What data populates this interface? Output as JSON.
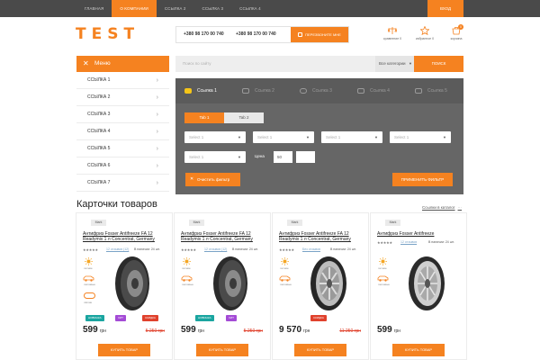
{
  "topnav": {
    "items": [
      "Главная",
      "О компании",
      "Ссылка 2",
      "Ссылка 3",
      "Ссылка 4"
    ],
    "active_index": 1,
    "login_label": "Вход"
  },
  "header": {
    "logo": "TEST",
    "phone1": "+380 98 170 00 740",
    "phone2": "+380 98 170 00 740",
    "callback_label": "Перезвоните мне",
    "compare_label": "сравнение 0",
    "favorites_label": "избранное 0",
    "cart_label": "корзина",
    "cart_count": "0"
  },
  "sidebar": {
    "menu_title": "Меню",
    "items": [
      "Ссылка 1",
      "Ссылка 2",
      "Ссылка 3",
      "Ссылка 4",
      "Ссылка 5",
      "Ссылка 6",
      "Ссылка 7"
    ]
  },
  "search": {
    "placeholder": "Поиск по сайту",
    "category": "Все категории",
    "button": "Поиск"
  },
  "filter": {
    "tabs": [
      "Ссылка 1",
      "Ссылка 2",
      "Ссылка 3",
      "Ссылка 4",
      "Ссылка 5"
    ],
    "subtabs": [
      "Tab 1",
      "Tab 2"
    ],
    "selects": [
      "Select 1",
      "Select 1",
      "Select 1",
      "Select 1",
      "Select 1"
    ],
    "price_label": "Цена",
    "price_from": "50",
    "price_to": "",
    "clear_label": "Очистить фильтр",
    "apply_label": "Применить фильтр"
  },
  "catalog": {
    "title": "Карточки товаров",
    "all_link": "Ссылки в каталог",
    "more": "···",
    "cards": [
      {
        "mark": "Mark",
        "name": "Антифриз Fosser Antifreeze FA 12 Readymix 1 л Concentrat, Germany",
        "reviews": "12 отзывов (12)",
        "stock": "В наличии: 24 шт.",
        "season": "летние",
        "car": "легковые",
        "extra": "лёгкие",
        "badges": [
          "Новинка",
          "Хит",
          "Скидка"
        ],
        "price": "599",
        "currency": "грн",
        "old_price": "5 250 грн",
        "buy": "Купить товар"
      },
      {
        "mark": "Mark",
        "name": "Антифриз Fosser Antifreeze FA 12 Readymix 1 л Concentrat, Germany",
        "reviews": "12 отзывов (12)",
        "stock": "В наличии: 24 шт.",
        "season": "летние",
        "car": "легковые",
        "extra": "",
        "badges": [
          "Новинка",
          "Хит"
        ],
        "price": "599",
        "currency": "грн",
        "old_price": "5 250 грн",
        "buy": "Купить товар"
      },
      {
        "mark": "Mark",
        "name": "Антифриз Fosser Antifreeze FA 12 Readymix 1 л Concentrat, Germany",
        "reviews": "Без отзывов",
        "stock": "В наличии: 24 шт.",
        "season": "летние",
        "car": "легковые",
        "extra": "",
        "badges": [
          "Скидка"
        ],
        "price": "9 570",
        "currency": "грн",
        "old_price": "11 250 грн",
        "buy": "Купить товар"
      },
      {
        "mark": "Mark",
        "name": "Антифриз Fosser Antifreeze",
        "reviews": "12 отзывов",
        "stock": "В наличии: 24 шт.",
        "season": "летние",
        "car": "легковые",
        "extra": "",
        "badges": [],
        "price": "599",
        "currency": "грн",
        "old_price": "",
        "buy": "Купить товар"
      }
    ]
  },
  "colors": {
    "accent": "#f58220",
    "badge_new": "#1aa5a0",
    "badge_hit": "#a44bd6",
    "badge_sale": "#e0412c"
  }
}
